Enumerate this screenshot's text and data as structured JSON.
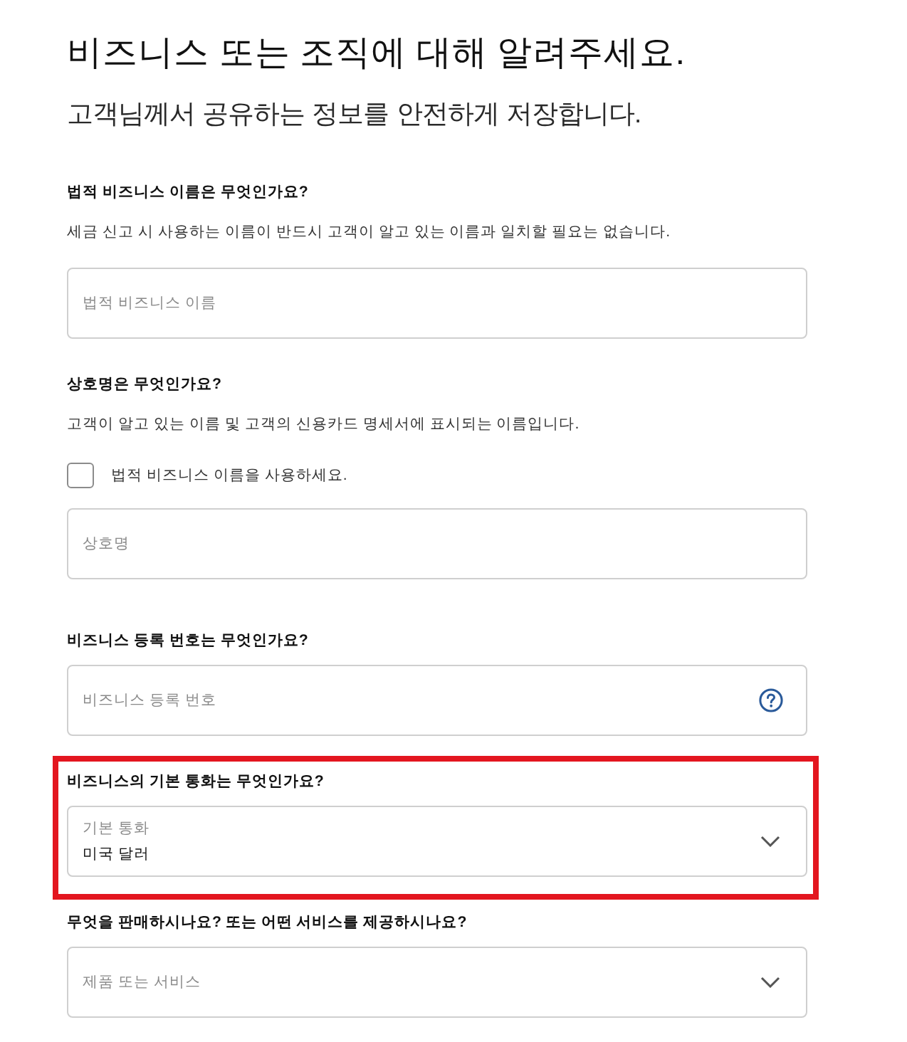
{
  "heading": {
    "title": "비즈니스 또는 조직에 대해 알려주세요.",
    "subtitle": "고객님께서 공유하는 정보를 안전하게 저장합니다."
  },
  "sections": [
    {
      "kind": "text",
      "question": "법적 비즈니스 이름은 무엇인가요?",
      "help": "세금 신고 시 사용하는 이름이 반드시 고객이 알고 있는 이름과 일치할 필요는 없습니다.",
      "field": {
        "placeholder": "법적 비즈니스 이름"
      },
      "highlighted": false
    },
    {
      "kind": "text",
      "question": "상호명은 무엇인가요?",
      "help": "고객이 알고 있는 이름 및 고객의 신용카드 명세서에 표시되는 이름입니다.",
      "checkbox": {
        "label": "법적 비즈니스 이름을 사용하세요.",
        "checked": false
      },
      "field": {
        "placeholder": "상호명"
      },
      "highlighted": false
    },
    {
      "kind": "text",
      "question": "비즈니스 등록 번호는 무엇인가요?",
      "field": {
        "placeholder": "비즈니스 등록 번호",
        "help_icon": true
      },
      "highlighted": false
    },
    {
      "kind": "select",
      "question": "비즈니스의 기본 통화는 무엇인가요?",
      "field": {
        "label": "기본 통화",
        "value": "미국 달러"
      },
      "highlighted": true
    },
    {
      "kind": "select",
      "question": "무엇을 판매하시나요? 또는 어떤 서비스를 제공하시나요?",
      "field": {
        "placeholder": "제품 또는 서비스"
      },
      "highlighted": false
    }
  ]
}
